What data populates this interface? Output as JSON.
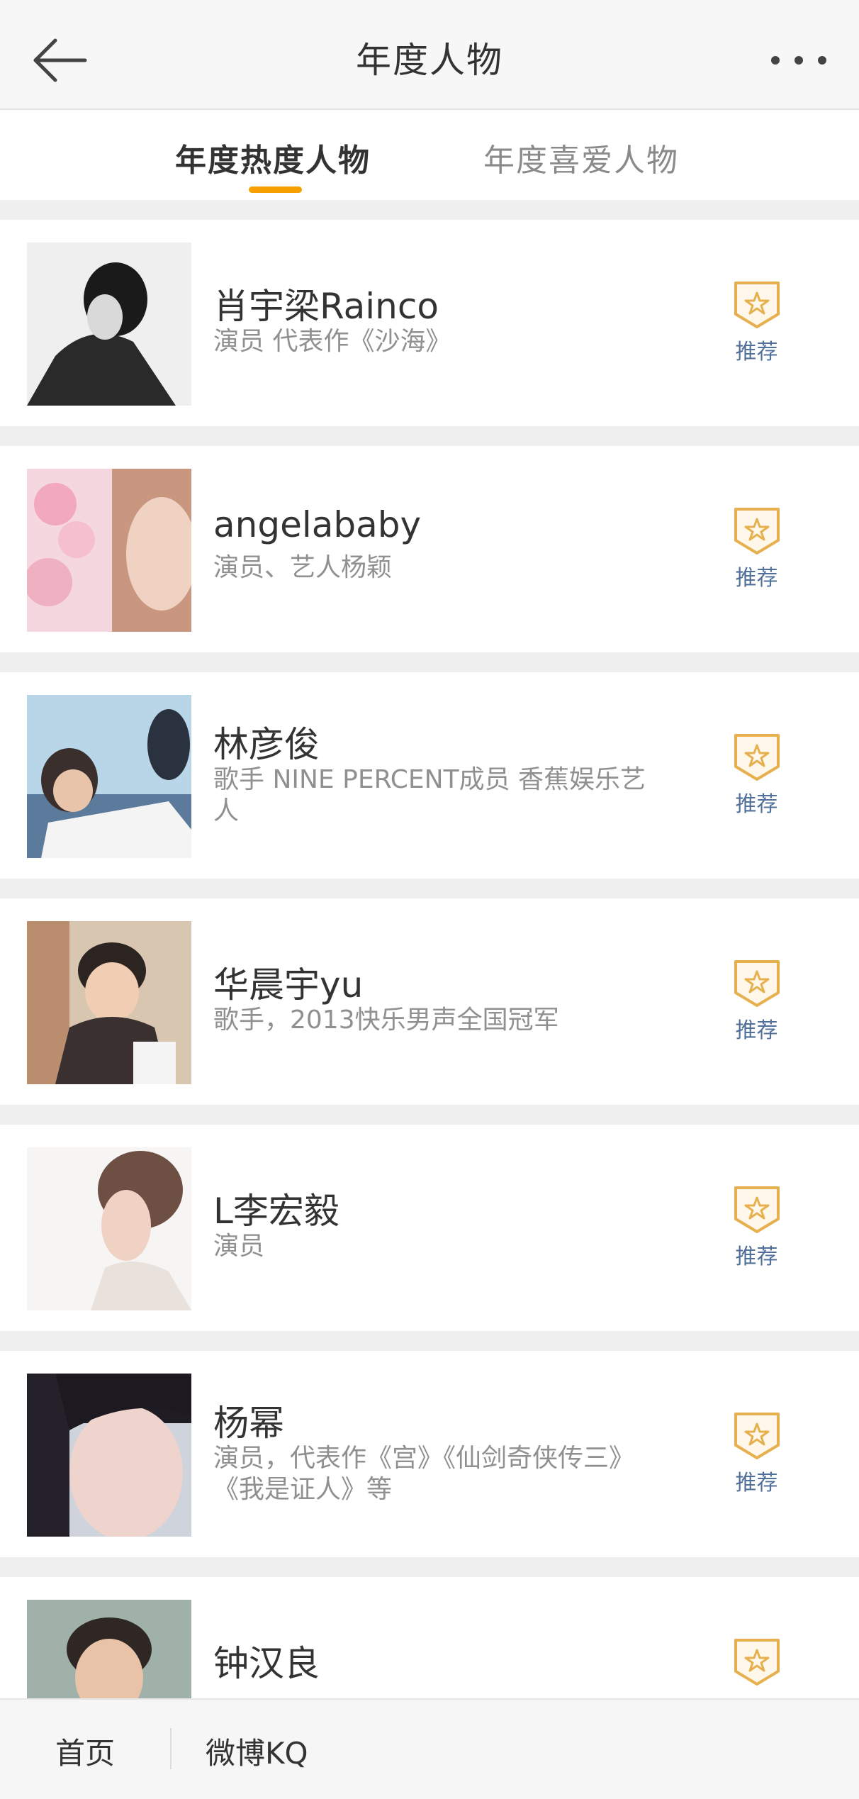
{
  "header": {
    "title": "年度人物",
    "back_icon": "arrow-left-icon",
    "more_icon": "more-dots-icon"
  },
  "tabs": [
    {
      "label": "年度热度人物",
      "active": true
    },
    {
      "label": "年度喜爱人物",
      "active": false
    }
  ],
  "colors": {
    "accent": "#f5a000",
    "badge": "#e7b04f",
    "recommend_text": "#50709a",
    "separator": "#efefef"
  },
  "people": [
    {
      "name": "肖宇梁Rainco",
      "desc": "演员 代表作《沙海》",
      "action": "推荐"
    },
    {
      "name": "angelababy",
      "desc": "演员、艺人杨颖",
      "action": "推荐"
    },
    {
      "name": "林彦俊",
      "desc": "歌手 NINE PERCENT成员 香蕉娱乐艺人",
      "action": "推荐"
    },
    {
      "name": "华晨宇yu",
      "desc": "歌手，2013快乐男声全国冠军",
      "action": "推荐"
    },
    {
      "name": "L李宏毅",
      "desc": "演员",
      "action": "推荐"
    },
    {
      "name": "杨幂",
      "desc": "演员，代表作《宫》《仙剑奇侠传三》《我是证人》等",
      "action": "推荐"
    },
    {
      "name": "钟汉良",
      "desc": "",
      "action": ""
    }
  ],
  "bottom_nav": {
    "home": "首页",
    "kq": "微博KQ"
  }
}
